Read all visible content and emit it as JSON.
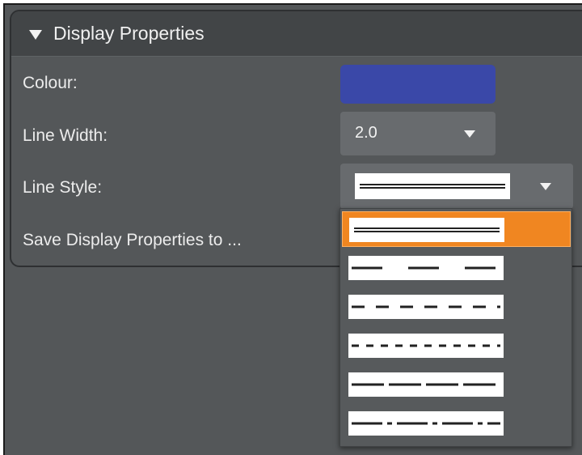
{
  "panel": {
    "title": "Display Properties",
    "expanded": true,
    "header_icon": "triangle-down-icon"
  },
  "properties": {
    "colour_label": "Colour:",
    "colour_value": "#3a48a8",
    "line_width_label": "Line Width:",
    "line_width_value": "2.0",
    "line_style_label": "Line Style:",
    "save_label": "Save Display Properties to ..."
  },
  "dropdown": {
    "options": [
      {
        "style": "solid",
        "selected": true
      },
      {
        "style": "long-dash",
        "selected": false
      },
      {
        "style": "dash",
        "selected": false
      },
      {
        "style": "short-dash",
        "selected": false
      },
      {
        "style": "medium-dash",
        "selected": false
      },
      {
        "style": "dash-dot",
        "selected": false
      }
    ]
  },
  "colors": {
    "accent_selected": "#f08621",
    "panel_bg": "#545759",
    "header_bg": "#424547",
    "combo_bg": "#686b6e"
  }
}
